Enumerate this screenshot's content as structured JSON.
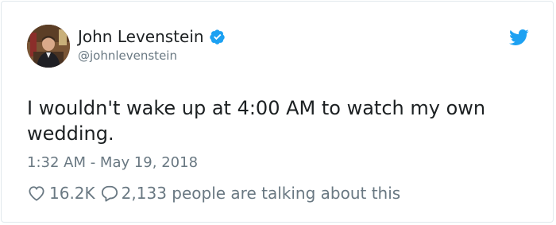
{
  "tweet": {
    "author": {
      "display_name": "John Levenstein",
      "handle": "@johnlevenstein",
      "verified": true,
      "avatar_icon": "avatar-photo"
    },
    "brand_icon": "twitter-bird-icon",
    "text": "I wouldn't wake up at 4:00 AM to watch my own wedding.",
    "timestamp": "1:32 AM - May 19, 2018",
    "likes": "16.2K",
    "conversation": "2,133 people are talking about this"
  },
  "colors": {
    "twitter_blue": "#1da1f2",
    "text_primary": "#1c2022",
    "text_secondary": "#697882",
    "border": "#e1e8ed"
  }
}
